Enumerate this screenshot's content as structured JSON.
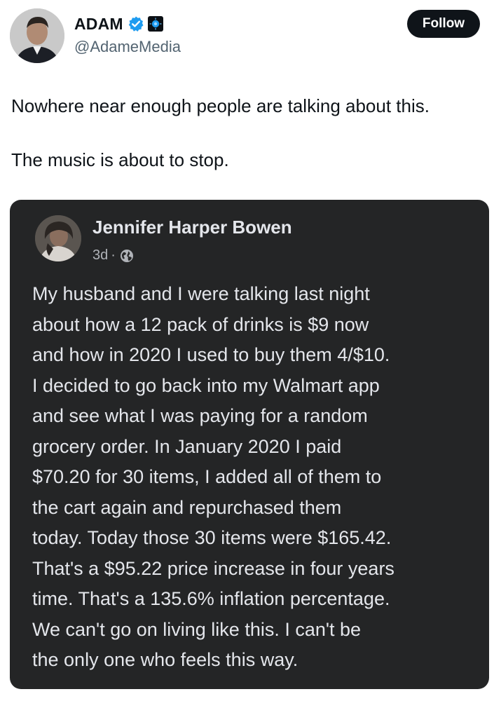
{
  "author": {
    "display_name": "ADAM",
    "handle": "@AdameMedia",
    "verified_color": "#1d9bf0"
  },
  "follow_label": "Follow",
  "tweet": {
    "lines": [
      "Nowhere near enough people are talking about this.",
      "The music is about to stop."
    ]
  },
  "embedded_post": {
    "author_name": "Jennifer Harper Bowen",
    "time": "3d",
    "separator": "·",
    "privacy_icon": "globe-icon",
    "body_lines": [
      "My husband and I were talking last night",
      "about how a 12 pack of drinks is $9 now",
      "and how in 2020 I used to buy them 4/$10.",
      "I decided to go back into my Walmart app",
      "and see what I was paying for a random",
      "grocery order. In January 2020 I paid",
      "$70.20 for 30 items, I added all of them to",
      "the cart again and repurchased them",
      "today. Today those 30 items were $165.42.",
      "That's a $95.22 price increase in four years",
      "time. That's a 135.6% inflation percentage.",
      "We can't go on living like this. I can't be",
      "the only one who feels this way."
    ]
  }
}
